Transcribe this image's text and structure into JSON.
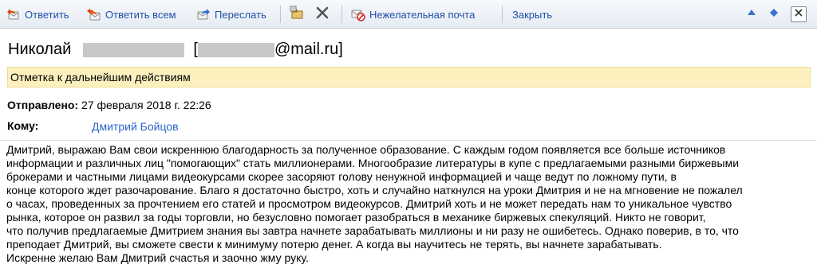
{
  "toolbar": {
    "reply_label": "Ответить",
    "reply_all_label": "Ответить всем",
    "forward_label": "Переслать",
    "junk_label": "Нежелательная почта",
    "close_label": "Закрыть"
  },
  "message": {
    "sender_name": "Николай",
    "sender_email_domain": "@mail.ru]",
    "bracket_open": "[",
    "flag_text": "Отметка к дальнейшим действиям",
    "sent_label": "Отправлено:",
    "sent_value": "27 февраля 2018 г. 22:26",
    "to_label": "Кому:",
    "to_value": "Дмитрий Бойцов",
    "body_lines": [
      "Дмитрий, выражаю Вам свои искреннюю благодарность за полученное образование. С каждым годом появляется все больше источников",
      "информации и различных лиц \"помогающих\" стать миллионерами.  Многообразие литературы в купе с предлагаемыми разными биржевыми",
      "брокерами и частными лицами видеокурсами скорее засоряют голову ненужной информацией и чаще ведут по ложному пути, в",
      "конце которого ждет разочарование. Благо я достаточно быстро, хоть и случайно наткнулся на уроки Дмитрия и не на мгновение не пожалел",
      "о часах, проведенных за прочтением его статей и просмотром видеокурсов. Дмитрий хоть и не может передать нам то уникальное чувство",
      "рынка, которое он развил за годы торговли, но безусловно помогает разобраться в механике биржевых спекуляций. Никто не говорит,",
      "что получив предлагаемые Дмитрием знания вы завтра начнете зарабатывать миллионы и ни разу не ошибетесь. Однако поверив, в то, что",
      "преподает Дмитрий, вы сможете свести к минимуму потерю денег. А когда вы научитесь не терять, вы начнете зарабатывать.",
      "Искренне желаю Вам Дмитрий счастья и заочно жму руку."
    ]
  },
  "colors": {
    "toolbar_text": "#1f4fa8",
    "flag_background": "#fcf0bf",
    "recipient_link": "#2a63c8",
    "redaction": "#c8c8c8"
  },
  "icons": [
    "reply-icon",
    "reply-all-icon",
    "forward-icon",
    "move-to-folder-icon",
    "delete-icon",
    "junk-icon",
    "previous-message-icon",
    "next-message-icon",
    "close-icon"
  ]
}
